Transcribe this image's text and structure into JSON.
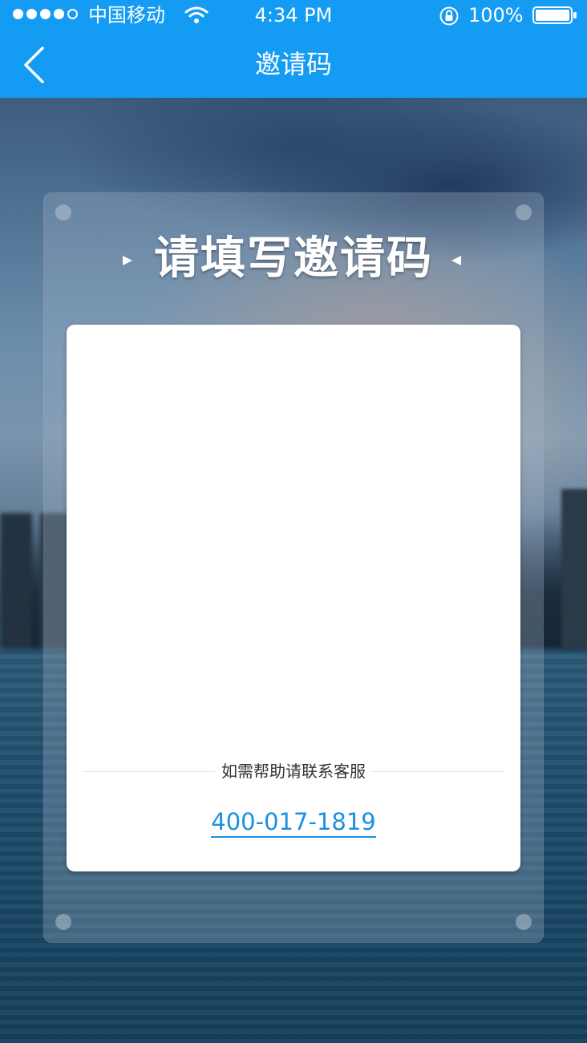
{
  "status_bar": {
    "carrier": "中国移动",
    "time": "4:34 PM",
    "battery": "100%",
    "signal_bars_filled": 4,
    "signal_bars_total": 5,
    "icons": [
      "wifi-icon",
      "orientation-lock-icon",
      "battery-icon"
    ]
  },
  "nav": {
    "title": "邀请码",
    "back_icon": "chevron-left-icon"
  },
  "card": {
    "heading": "请填写邀请码",
    "help_text": "如需帮助请联系客服",
    "phone": "400-017-1819"
  },
  "colors": {
    "accent": "#149bf3",
    "link": "#1a8fe3"
  }
}
